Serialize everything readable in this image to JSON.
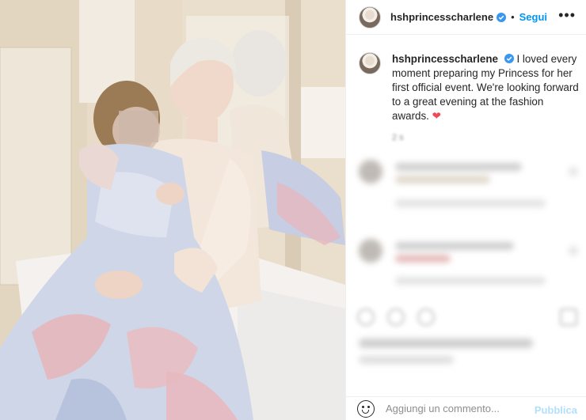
{
  "post": {
    "username": "hshprincesscharlene",
    "follow_label": "Segui",
    "separator": "•",
    "more_label": "•••",
    "caption_username": "hshprincesscharlene",
    "caption_text": "I loved every moment preparing my Princess for her first official event. We're looking forward to a great evening at the fashion awards.",
    "caption_emoji": "❤",
    "time_fragment": "2 s"
  },
  "comment_box": {
    "placeholder": "Aggiungi un commento...",
    "publish_label": "Pubblica"
  },
  "colors": {
    "accent": "#0095f6",
    "publish_disabled": "#b2dffc",
    "verified": "#3897f0",
    "heart": "#ed4956"
  },
  "icons": {
    "verified": "verified-badge-icon",
    "more": "more-options-icon",
    "emoji": "emoji-icon"
  }
}
